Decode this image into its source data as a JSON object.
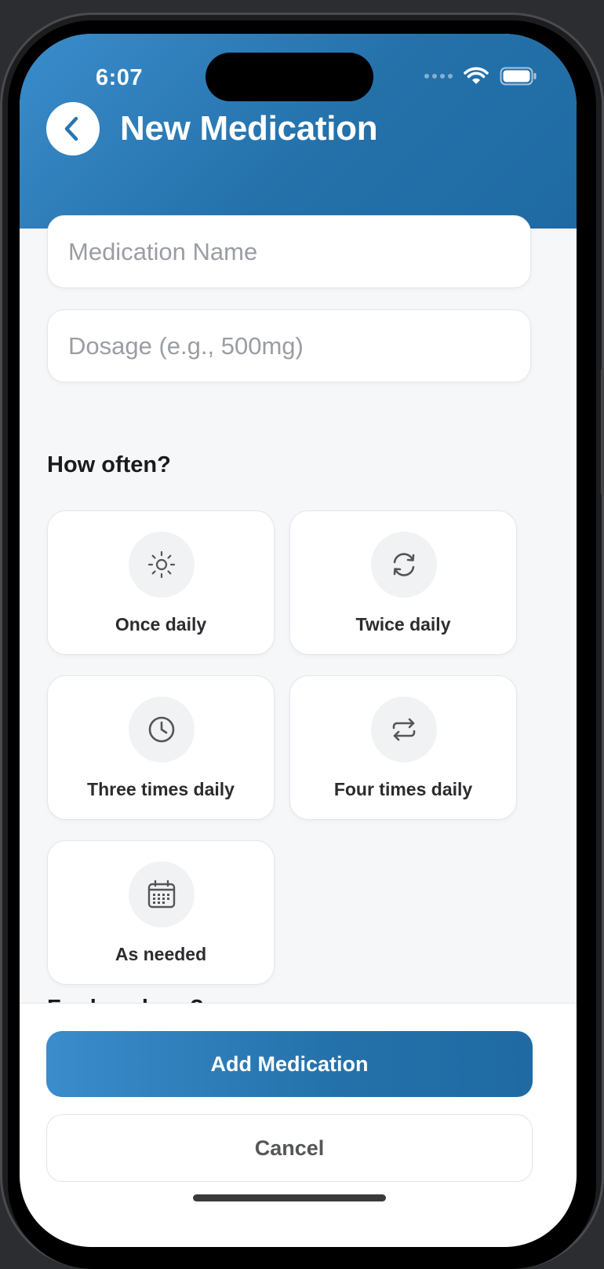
{
  "status_bar": {
    "time": "6:07"
  },
  "header": {
    "title": "New Medication",
    "back_icon": "chevron-left-icon",
    "accent_color": "#2874b0"
  },
  "form": {
    "medication_name": {
      "value": "",
      "placeholder": "Medication Name"
    },
    "dosage": {
      "value": "",
      "placeholder": "Dosage (e.g., 500mg)"
    }
  },
  "frequency": {
    "title": "How often?",
    "options": [
      {
        "label": "Once daily",
        "icon": "sun-icon"
      },
      {
        "label": "Twice daily",
        "icon": "refresh-icon"
      },
      {
        "label": "Three times daily",
        "icon": "clock-icon"
      },
      {
        "label": "Four times daily",
        "icon": "repeat-icon"
      },
      {
        "label": "As needed",
        "icon": "calendar-icon"
      }
    ]
  },
  "duration": {
    "title": "For how long?"
  },
  "actions": {
    "add_label": "Add Medication",
    "cancel_label": "Cancel"
  }
}
